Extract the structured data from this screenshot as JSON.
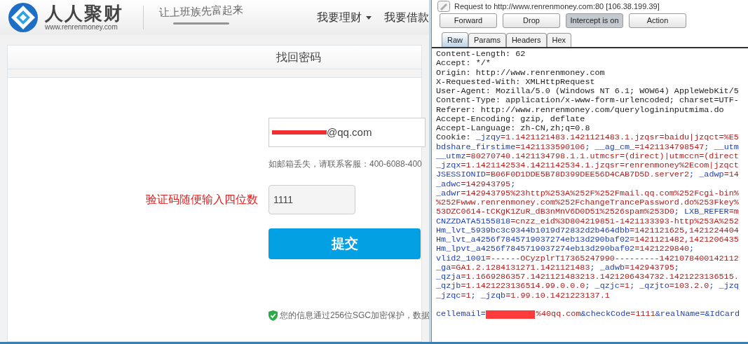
{
  "site": {
    "logo_name": "人人聚财",
    "logo_url": "www.renrenmoney.com",
    "slogan": "让上班族先富起来",
    "nav": [
      {
        "label": "我要理财",
        "dropdown": true
      },
      {
        "label": "我要借款",
        "dropdown": false
      }
    ]
  },
  "form": {
    "title": "找回密码",
    "email_value": "@qq.com",
    "email_redacted": true,
    "hint": "如邮箱丢失，请联系客服：400-6088-400",
    "annotation": "验证码随便输入四位数",
    "code_value": "1111",
    "submit": "提交",
    "security_note": "您的信息通过256位SGC加密保护，数据"
  },
  "proxy": {
    "request_line": "Request to http://www.renrenmoney.com:80  [106.38.199.39]",
    "buttons": [
      {
        "label": "Forward",
        "pressed": false
      },
      {
        "label": "Drop",
        "pressed": false
      },
      {
        "label": "Intercept is on",
        "pressed": true
      },
      {
        "label": "Action",
        "pressed": false
      }
    ],
    "tabs": [
      {
        "label": "Raw",
        "selected": true
      },
      {
        "label": "Params",
        "selected": false
      },
      {
        "label": "Headers",
        "selected": false
      },
      {
        "label": "Hex",
        "selected": false
      }
    ],
    "lines": [
      [
        {
          "kind": "plain",
          "text": "Content-Length: 62"
        }
      ],
      [
        {
          "kind": "plain",
          "text": "Accept: */*"
        }
      ],
      [
        {
          "kind": "plain",
          "text": "Origin: http://www.renrenmoney.com"
        }
      ],
      [
        {
          "kind": "plain",
          "text": "X-Requested-With: XMLHttpRequest"
        }
      ],
      [
        {
          "kind": "plain",
          "text": "User-Agent: Mozilla/5.0 (Windows NT 6.1; WOW64) AppleWebKit/5"
        }
      ],
      [
        {
          "kind": "plain",
          "text": "Content-Type: application/x-www-form-urlencoded; charset=UTF-"
        }
      ],
      [
        {
          "kind": "plain",
          "text": "Referer: http://www.renrenmoney.com/querylogininputmima.do"
        }
      ],
      [
        {
          "kind": "plain",
          "text": "Accept-Encoding: gzip, deflate"
        }
      ],
      [
        {
          "kind": "plain",
          "text": "Accept-Language: zh-CN,zh;q=0.8"
        }
      ],
      [
        {
          "kind": "plain",
          "text": "Cookie: "
        },
        {
          "kind": "key",
          "text": "_jzqy"
        },
        {
          "kind": "value",
          "text": "=1.1421121483.1421121483.1.jzqsr=baidu|jzqct=%E5"
        }
      ],
      [
        {
          "kind": "key",
          "text": "bdshare_firstime"
        },
        {
          "kind": "value",
          "text": "=1421133590106"
        },
        {
          "kind": "key",
          "text": "; __ag_cm_"
        },
        {
          "kind": "value",
          "text": "=1421134798547"
        },
        {
          "kind": "key",
          "text": "; __utm"
        }
      ],
      [
        {
          "kind": "key",
          "text": "__utmz"
        },
        {
          "kind": "value",
          "text": "=80270740.1421134798.1.1.utmcsr=(direct)|utmccn=(direct"
        }
      ],
      [
        {
          "kind": "key",
          "text": "_jzqx"
        },
        {
          "kind": "value",
          "text": "=1.1421142534.1421142534.1.jzqsr=renrenmoney%2Ecom|jzqct"
        }
      ],
      [
        {
          "kind": "key",
          "text": "JSESSIONID"
        },
        {
          "kind": "value",
          "text": "=B06F0D1DDE5B78D399DEE56D4CAB7D5D.server2"
        },
        {
          "kind": "key",
          "text": "; _adwp"
        },
        {
          "kind": "value",
          "text": "=14"
        }
      ],
      [
        {
          "kind": "key",
          "text": "_adwc"
        },
        {
          "kind": "value",
          "text": "=142943795"
        },
        {
          "kind": "key",
          "text": ";"
        }
      ],
      [
        {
          "kind": "key",
          "text": "_adwr"
        },
        {
          "kind": "value",
          "text": "=142943795%23http%253A%252F%252Fmail.qq.com%252Fcgi-bin%"
        }
      ],
      [
        {
          "kind": "value",
          "text": "%252Fwww.renrenmoney.com%252FchangeTrancePassword.do%253Fkey%"
        }
      ],
      [
        {
          "kind": "value",
          "text": "53DZC0614-tCKgK1ZuR_dB3nMnV6D0D51%2526spam%253D0"
        },
        {
          "kind": "key",
          "text": "; LXB_REFER"
        },
        {
          "kind": "value",
          "text": "=m"
        }
      ],
      [
        {
          "kind": "key",
          "text": "CNZZDATA5155818"
        },
        {
          "kind": "value",
          "text": "=cnzz_eid%3D804219851-1421133393-http%253A%252"
        }
      ],
      [
        {
          "kind": "key",
          "text": "Hm_lvt_5939bc3c9344b1019d72832d2b464dbb"
        },
        {
          "kind": "value",
          "text": "=1421121625,1421224404"
        }
      ],
      [
        {
          "kind": "key",
          "text": "Hm_lvt_a4256f7845719037274eb13d290baf02"
        },
        {
          "kind": "value",
          "text": "=1421121482,1421206435"
        }
      ],
      [
        {
          "kind": "key",
          "text": "Hm_lpvt_a4256f7845719037274eb13d290baf02"
        },
        {
          "kind": "value",
          "text": "=1421229840"
        },
        {
          "kind": "key",
          "text": ";"
        }
      ],
      [
        {
          "kind": "key",
          "text": "vlid2_1001"
        },
        {
          "kind": "value",
          "text": "=------OCyzplrT17365247990---------1421078400142112"
        }
      ],
      [
        {
          "kind": "key",
          "text": "_ga"
        },
        {
          "kind": "value",
          "text": "=GA1.2.1284131271.1421121483"
        },
        {
          "kind": "key",
          "text": "; _adwb"
        },
        {
          "kind": "value",
          "text": "=142943795"
        },
        {
          "kind": "key",
          "text": ";"
        }
      ],
      [
        {
          "kind": "key",
          "text": "_qzja"
        },
        {
          "kind": "value",
          "text": "=1.1669286357.1421121483213.1421206434732.1421223136515."
        }
      ],
      [
        {
          "kind": "key",
          "text": "_qzjb"
        },
        {
          "kind": "value",
          "text": "=1.1421223136514.99.0.0.0"
        },
        {
          "kind": "key",
          "text": "; _qzjc"
        },
        {
          "kind": "value",
          "text": "=1"
        },
        {
          "kind": "key",
          "text": "; _qzjto"
        },
        {
          "kind": "value",
          "text": "=103.2.0"
        },
        {
          "kind": "key",
          "text": "; _jzq"
        }
      ],
      [
        {
          "kind": "key",
          "text": "_jzqc"
        },
        {
          "kind": "value",
          "text": "=1"
        },
        {
          "kind": "key",
          "text": "; _jzqb"
        },
        {
          "kind": "value",
          "text": "=1.99.10.1421223137.1"
        }
      ]
    ],
    "body": [
      {
        "kind": "key",
        "text": "cellemail"
      },
      {
        "kind": "key",
        "text": "="
      },
      {
        "kind": "redaction"
      },
      {
        "kind": "value",
        "text": "%40qq.com"
      },
      {
        "kind": "key",
        "text": "&checkCode"
      },
      {
        "kind": "value",
        "text": "=1111"
      },
      {
        "kind": "key",
        "text": "&realName=&IdCard"
      }
    ]
  }
}
